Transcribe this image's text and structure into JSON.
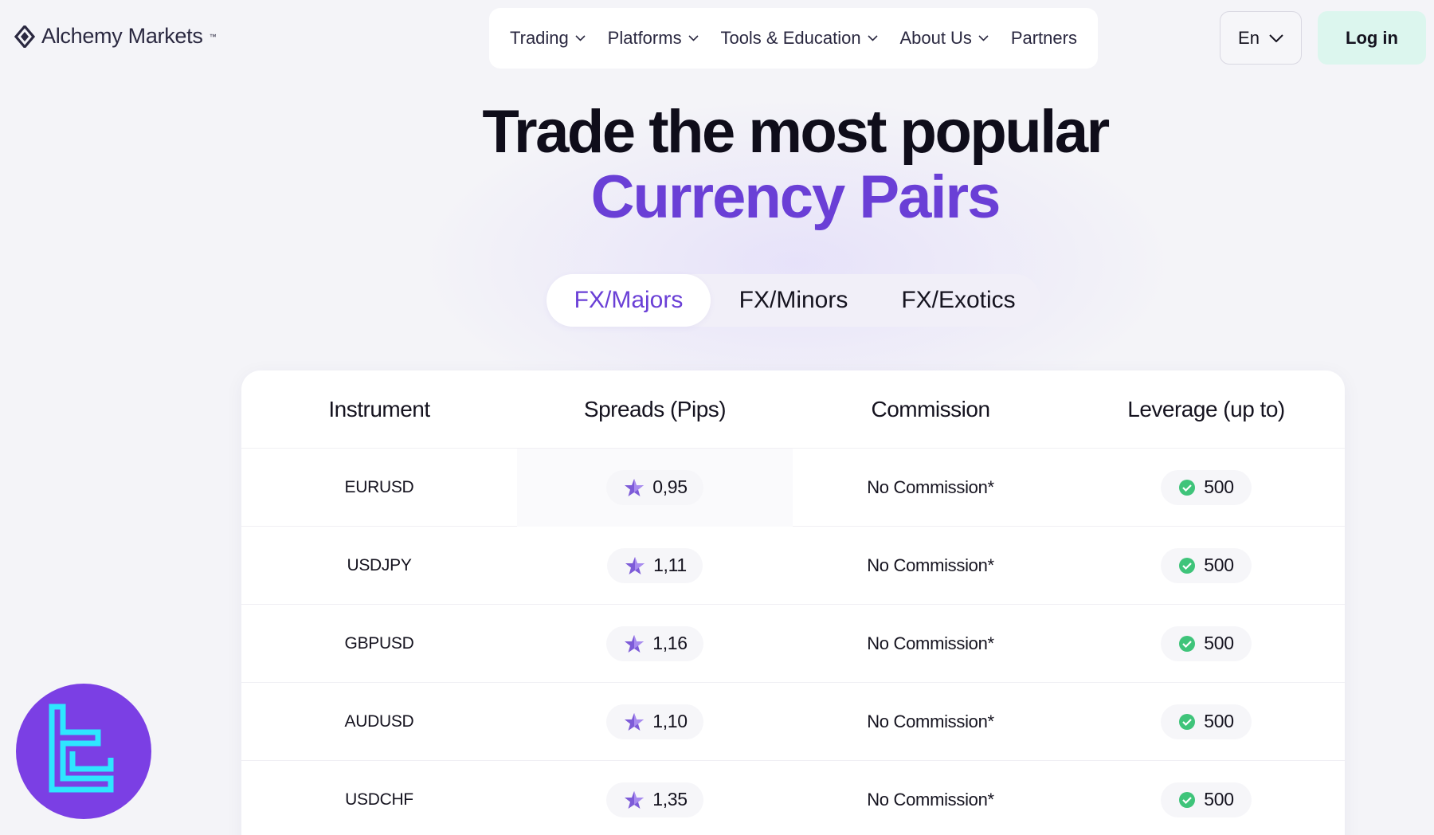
{
  "brand": {
    "name": "Alchemy Markets",
    "tm": "™"
  },
  "nav": {
    "items": [
      {
        "label": "Trading",
        "has_dropdown": true
      },
      {
        "label": "Platforms",
        "has_dropdown": true
      },
      {
        "label": "Tools & Education",
        "has_dropdown": true
      },
      {
        "label": "About Us",
        "has_dropdown": true
      },
      {
        "label": "Partners",
        "has_dropdown": false
      }
    ]
  },
  "header": {
    "language": "En",
    "login_label": "Log in"
  },
  "hero": {
    "title": "Trade the most popular",
    "subtitle": "Currency Pairs"
  },
  "tabs": [
    {
      "label": "FX/Majors",
      "active": true
    },
    {
      "label": "FX/Minors",
      "active": false
    },
    {
      "label": "FX/Exotics",
      "active": false
    }
  ],
  "table": {
    "headers": [
      "Instrument",
      "Spreads (Pips)",
      "Commission",
      "Leverage (up to)"
    ],
    "rows": [
      {
        "instrument": "EURUSD",
        "spread": "0,95",
        "commission": "No Commission*",
        "leverage": "500"
      },
      {
        "instrument": "USDJPY",
        "spread": "1,11",
        "commission": "No Commission*",
        "leverage": "500"
      },
      {
        "instrument": "GBPUSD",
        "spread": "1,16",
        "commission": "No Commission*",
        "leverage": "500"
      },
      {
        "instrument": "AUDUSD",
        "spread": "1,10",
        "commission": "No Commission*",
        "leverage": "500"
      },
      {
        "instrument": "USDCHF",
        "spread": "1,35",
        "commission": "No Commission*",
        "leverage": "500"
      }
    ]
  },
  "colors": {
    "accent": "#6a3fd6",
    "login_bg": "#dcf6ee",
    "check": "#3fc47a",
    "badge": "#7b3fe4",
    "badge_glyph": "#2ee6ff"
  },
  "icons": {
    "logo": "diamond-logo-icon",
    "nav_dropdown": "chevron-down-icon",
    "spread": "star-icon",
    "leverage": "check-badge-icon",
    "watermark": "tc-logo-icon"
  }
}
